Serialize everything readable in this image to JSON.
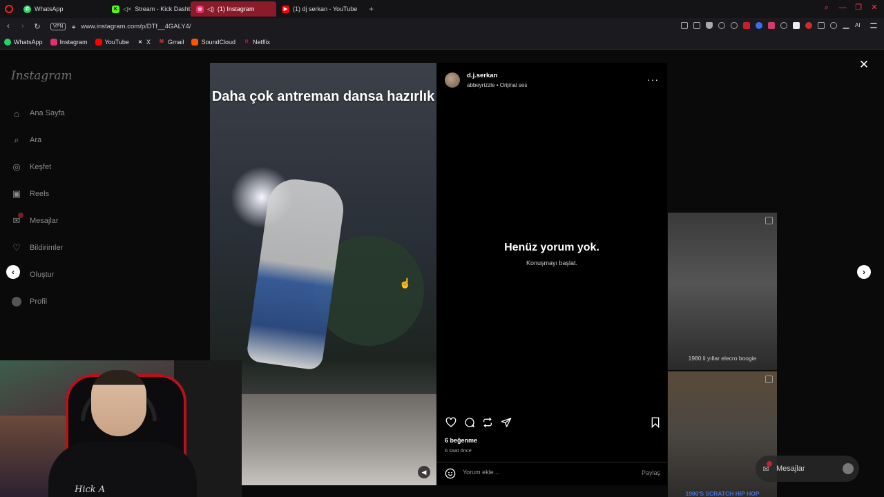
{
  "browser": {
    "tabs": [
      {
        "label": "WhatsApp",
        "icon": "whatsapp-icon",
        "color": "#25d366"
      },
      {
        "label": "Stream - Kick Dashbo",
        "icon": "kick-icon",
        "color": "#53fc18"
      },
      {
        "label": "(1) Instagram",
        "icon": "instagram-icon",
        "color": "#e1306c",
        "active": true
      },
      {
        "label": "(1) dj serkan - YouTube",
        "icon": "youtube-icon",
        "color": "#ff0000"
      }
    ],
    "new_tab": "+",
    "url": "www.instagram.com/p/DTf__4GALY4/",
    "vpn_label": "VPN",
    "ai_label": "AI",
    "bookmarks": [
      {
        "label": "WhatsApp",
        "icon": "whatsapp-icon",
        "color": "#25d366"
      },
      {
        "label": "Instagram",
        "icon": "instagram-icon",
        "color": "#e1306c"
      },
      {
        "label": "YouTube",
        "icon": "youtube-icon",
        "color": "#ff0000"
      },
      {
        "label": "X",
        "icon": "x-icon",
        "color": "#000000"
      },
      {
        "label": "Gmail",
        "icon": "gmail-icon",
        "color": "#ea4335"
      },
      {
        "label": "SoundCloud",
        "icon": "soundcloud-icon",
        "color": "#ff5500"
      },
      {
        "label": "Netflix",
        "icon": "netflix-icon",
        "color": "#e50914"
      }
    ]
  },
  "sidebar": {
    "logo": "Instagram",
    "items": [
      {
        "label": "Ana Sayfa",
        "icon": "home-icon"
      },
      {
        "label": "Ara",
        "icon": "search-icon"
      },
      {
        "label": "Keşfet",
        "icon": "compass-icon"
      },
      {
        "label": "Reels",
        "icon": "reels-icon"
      },
      {
        "label": "Mesajlar",
        "icon": "messenger-icon"
      },
      {
        "label": "Bildirimler",
        "icon": "heart-icon"
      },
      {
        "label": "Oluştur",
        "icon": "plus-icon"
      },
      {
        "label": "Profil",
        "icon": "avatar-icon"
      }
    ]
  },
  "post": {
    "caption": "Daha çok antreman dansa hazırlık",
    "author": "d.j.serkan",
    "audio_user": "abbeyrizzle",
    "audio_sep": "•",
    "audio_label": "Orijinal ses",
    "empty_title": "Henüz yorum yok.",
    "empty_sub": "Konuşmayı başlat.",
    "likes": "6 beğenme",
    "time_ago": "6 saat önce",
    "comment_placeholder": "Yorum ekle...",
    "share_label": "Paylaş"
  },
  "background": {
    "thumb_label_1": "1980 li yıllar elecro boogie",
    "thumb_label_2": "1980'S SCRATCH HIP HOP"
  },
  "webcam": {
    "shirt_text": "Hick A"
  },
  "messages_chip": {
    "label": "Mesajlar"
  }
}
